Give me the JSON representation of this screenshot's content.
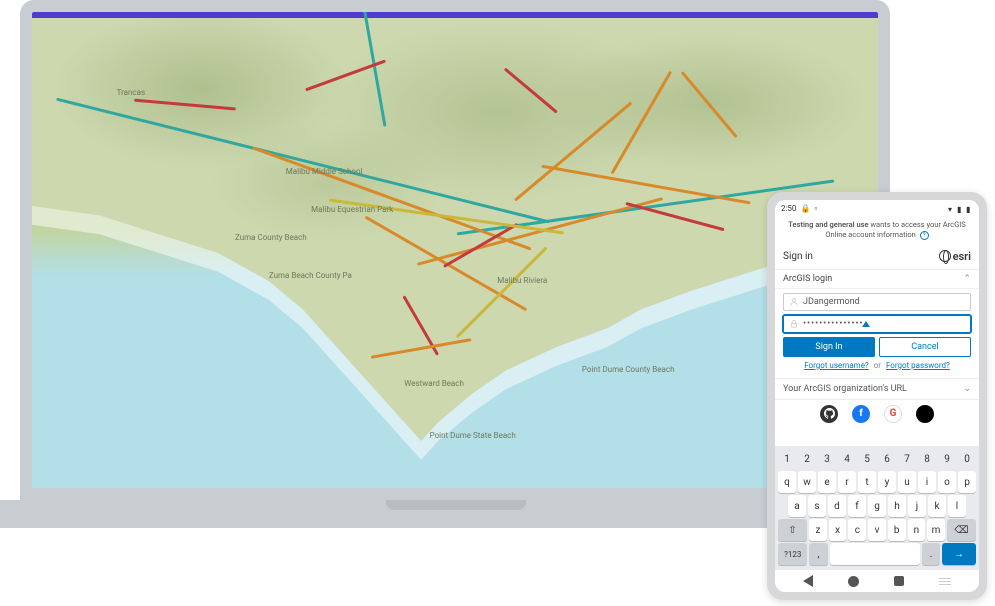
{
  "map": {
    "labels": {
      "trancas": "Trancas",
      "malibu_middle": "Malibu Middle School",
      "malibu_equestrian": "Malibu Equestrian Park",
      "zuma_county_beach": "Zuma County Beach",
      "zuma_beach_county": "Zuma Beach County Pa",
      "malibu_riviera": "Malibu Riviera",
      "westward_beach": "Westward Beach",
      "point_dume_county": "Point Dume County Beach",
      "point_dume_state": "Point Dume State Beach"
    }
  },
  "phone": {
    "status": {
      "time": "2:50"
    },
    "banner": {
      "app": "Testing and general use",
      "text": " wants to access your ArcGIS Online account information"
    },
    "signin_title": "Sign in",
    "brand": "esri",
    "arcgis_login": "ArcGIS login",
    "username": "JDangermond",
    "password": "•••••••••••••••",
    "btn_signin": "Sign In",
    "btn_cancel": "Cancel",
    "forgot_user": "Forgot username?",
    "or": "or",
    "forgot_pass": "Forgot password?",
    "org_url": "Your ArcGIS organization's URL",
    "keyboard": {
      "row1": [
        "1",
        "2",
        "3",
        "4",
        "5",
        "6",
        "7",
        "8",
        "9",
        "0"
      ],
      "row2": [
        "q",
        "w",
        "e",
        "r",
        "t",
        "y",
        "u",
        "i",
        "o",
        "p"
      ],
      "row3": [
        "a",
        "s",
        "d",
        "f",
        "g",
        "h",
        "j",
        "k",
        "l"
      ],
      "row4": [
        "z",
        "x",
        "c",
        "v",
        "b",
        "n",
        "m"
      ],
      "shift": "⇧",
      "backspace": "⌫",
      "sym": "?123",
      "comma": ",",
      "period": ".",
      "enter": "→"
    }
  }
}
